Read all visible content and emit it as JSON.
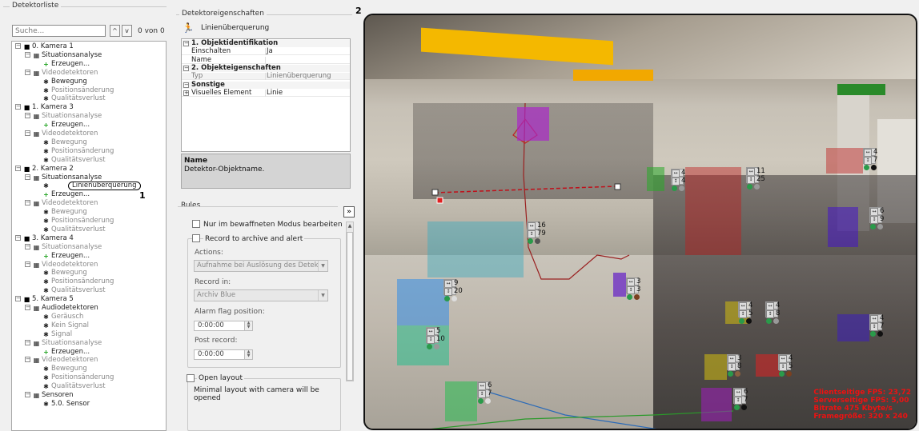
{
  "detector_list": {
    "title": "Detektorliste",
    "search_placeholder": "Suche...",
    "counter": "0 von 0",
    "nav_up": "^",
    "nav_down": "v",
    "tree": [
      {
        "label": "0. Kamera 1",
        "kind": "camera"
      },
      {
        "label": "Situationsanalyse",
        "kind": "group"
      },
      {
        "label": "Erzeugen...",
        "kind": "create"
      },
      {
        "label": "Videodetektoren",
        "kind": "group-dis"
      },
      {
        "label": "Bewegung",
        "kind": "item"
      },
      {
        "label": "Positionsänderung",
        "kind": "item-dis"
      },
      {
        "label": "Qualitätsverlust",
        "kind": "item-dis"
      },
      {
        "label": "1. Kamera 3",
        "kind": "camera"
      },
      {
        "label": "Situationsanalyse",
        "kind": "group-dis"
      },
      {
        "label": "Erzeugen...",
        "kind": "create"
      },
      {
        "label": "Videodetektoren",
        "kind": "group-dis"
      },
      {
        "label": "Bewegung",
        "kind": "item-dis"
      },
      {
        "label": "Positionsänderung",
        "kind": "item-dis"
      },
      {
        "label": "Qualitätsverlust",
        "kind": "item-dis"
      },
      {
        "label": "2. Kamera 2",
        "kind": "camera"
      },
      {
        "label": "Situationsanalyse",
        "kind": "group"
      },
      {
        "label": "Linienüberquerung",
        "kind": "selected"
      },
      {
        "label": "Erzeugen...",
        "kind": "create"
      },
      {
        "label": "Videodetektoren",
        "kind": "group-dis"
      },
      {
        "label": "Bewegung",
        "kind": "item-dis"
      },
      {
        "label": "Positionsänderung",
        "kind": "item-dis"
      },
      {
        "label": "Qualitätsverlust",
        "kind": "item-dis"
      },
      {
        "label": "3. Kamera 4",
        "kind": "camera"
      },
      {
        "label": "Situationsanalyse",
        "kind": "group-dis"
      },
      {
        "label": "Erzeugen...",
        "kind": "create"
      },
      {
        "label": "Videodetektoren",
        "kind": "group-dis"
      },
      {
        "label": "Bewegung",
        "kind": "item-dis"
      },
      {
        "label": "Positionsänderung",
        "kind": "item-dis"
      },
      {
        "label": "Qualitätsverlust",
        "kind": "item-dis"
      },
      {
        "label": "5. Kamera 5",
        "kind": "camera"
      },
      {
        "label": "Audiodetektoren",
        "kind": "group"
      },
      {
        "label": "Geräusch",
        "kind": "item-dis"
      },
      {
        "label": "Kein Signal",
        "kind": "item-dis"
      },
      {
        "label": "Signal",
        "kind": "item-dis"
      },
      {
        "label": "Situationsanalyse",
        "kind": "group-dis"
      },
      {
        "label": "Erzeugen...",
        "kind": "create"
      },
      {
        "label": "Videodetektoren",
        "kind": "group-dis"
      },
      {
        "label": "Bewegung",
        "kind": "item-dis"
      },
      {
        "label": "Positionsänderung",
        "kind": "item-dis"
      },
      {
        "label": "Qualitätsverlust",
        "kind": "item-dis"
      },
      {
        "label": "Sensoren",
        "kind": "group"
      },
      {
        "label": "5.0. Sensor",
        "kind": "item"
      }
    ]
  },
  "callouts": {
    "one": "1",
    "two": "2"
  },
  "properties": {
    "title": "Detektoreigenschaften",
    "object_name": "Linienüberquerung",
    "rows": [
      {
        "key": "1. Objektidentifikation",
        "value": "",
        "type": "cat"
      },
      {
        "key": "Einschalten",
        "value": "Ja",
        "type": "row"
      },
      {
        "key": "Name",
        "value": "",
        "type": "row"
      },
      {
        "key": "2. Objekteigenschaften",
        "value": "",
        "type": "cat"
      },
      {
        "key": "Typ",
        "value": "Linienüberquerung",
        "type": "dim"
      },
      {
        "key": "Sonstige",
        "value": "",
        "type": "cat"
      },
      {
        "key": "Visuelles Element",
        "value": "Linie",
        "type": "row"
      }
    ],
    "description_title": "Name",
    "description_text": "Detektor-Objektname."
  },
  "rules": {
    "title": "Rules",
    "expand_label": "»",
    "edit_armed_only": "Nur im bewaffneten Modus bearbeiten",
    "record_to_archive": "Record to archive and alert",
    "actions_label": "Actions:",
    "actions_value": "Aufnahme bei Auslösung des Detekt",
    "record_in_label": "Record in:",
    "record_in_value": "Archiv Blue",
    "alarm_flag_label": "Alarm flag position:",
    "alarm_flag_value": "0:00:00",
    "post_record_label": "Post record:",
    "post_record_value": "0:00:00",
    "open_layout": "Open layout",
    "open_layout_note": "Minimal layout with camera will be opened"
  },
  "video": {
    "tags": [
      {
        "a": "4",
        "b": "7"
      },
      {
        "a": "11",
        "b": "25"
      },
      {
        "a": "4",
        "b": "4"
      },
      {
        "a": "6",
        "b": "9"
      },
      {
        "a": "16",
        "b": "79"
      },
      {
        "a": "9",
        "b": "20"
      },
      {
        "a": "3",
        "b": "3"
      },
      {
        "a": "4",
        "b": "5"
      },
      {
        "a": "4",
        "b": "8"
      },
      {
        "a": "4",
        "b": "7"
      },
      {
        "a": "5",
        "b": "10"
      },
      {
        "a": "3",
        "b": "8"
      },
      {
        "a": "4",
        "b": "5"
      },
      {
        "a": "6",
        "b": "7"
      },
      {
        "a": "6",
        "b": "7"
      }
    ],
    "stats": [
      "Clientseitige FPS: 23,72",
      "Serverseitige FPS: 5,00",
      "Bitrate 475 Kbyte/s",
      "Framegröße: 320 x 240"
    ],
    "colors": {
      "line": "#c0101a",
      "track": "#a01a1a",
      "stats": "#e01010"
    }
  }
}
